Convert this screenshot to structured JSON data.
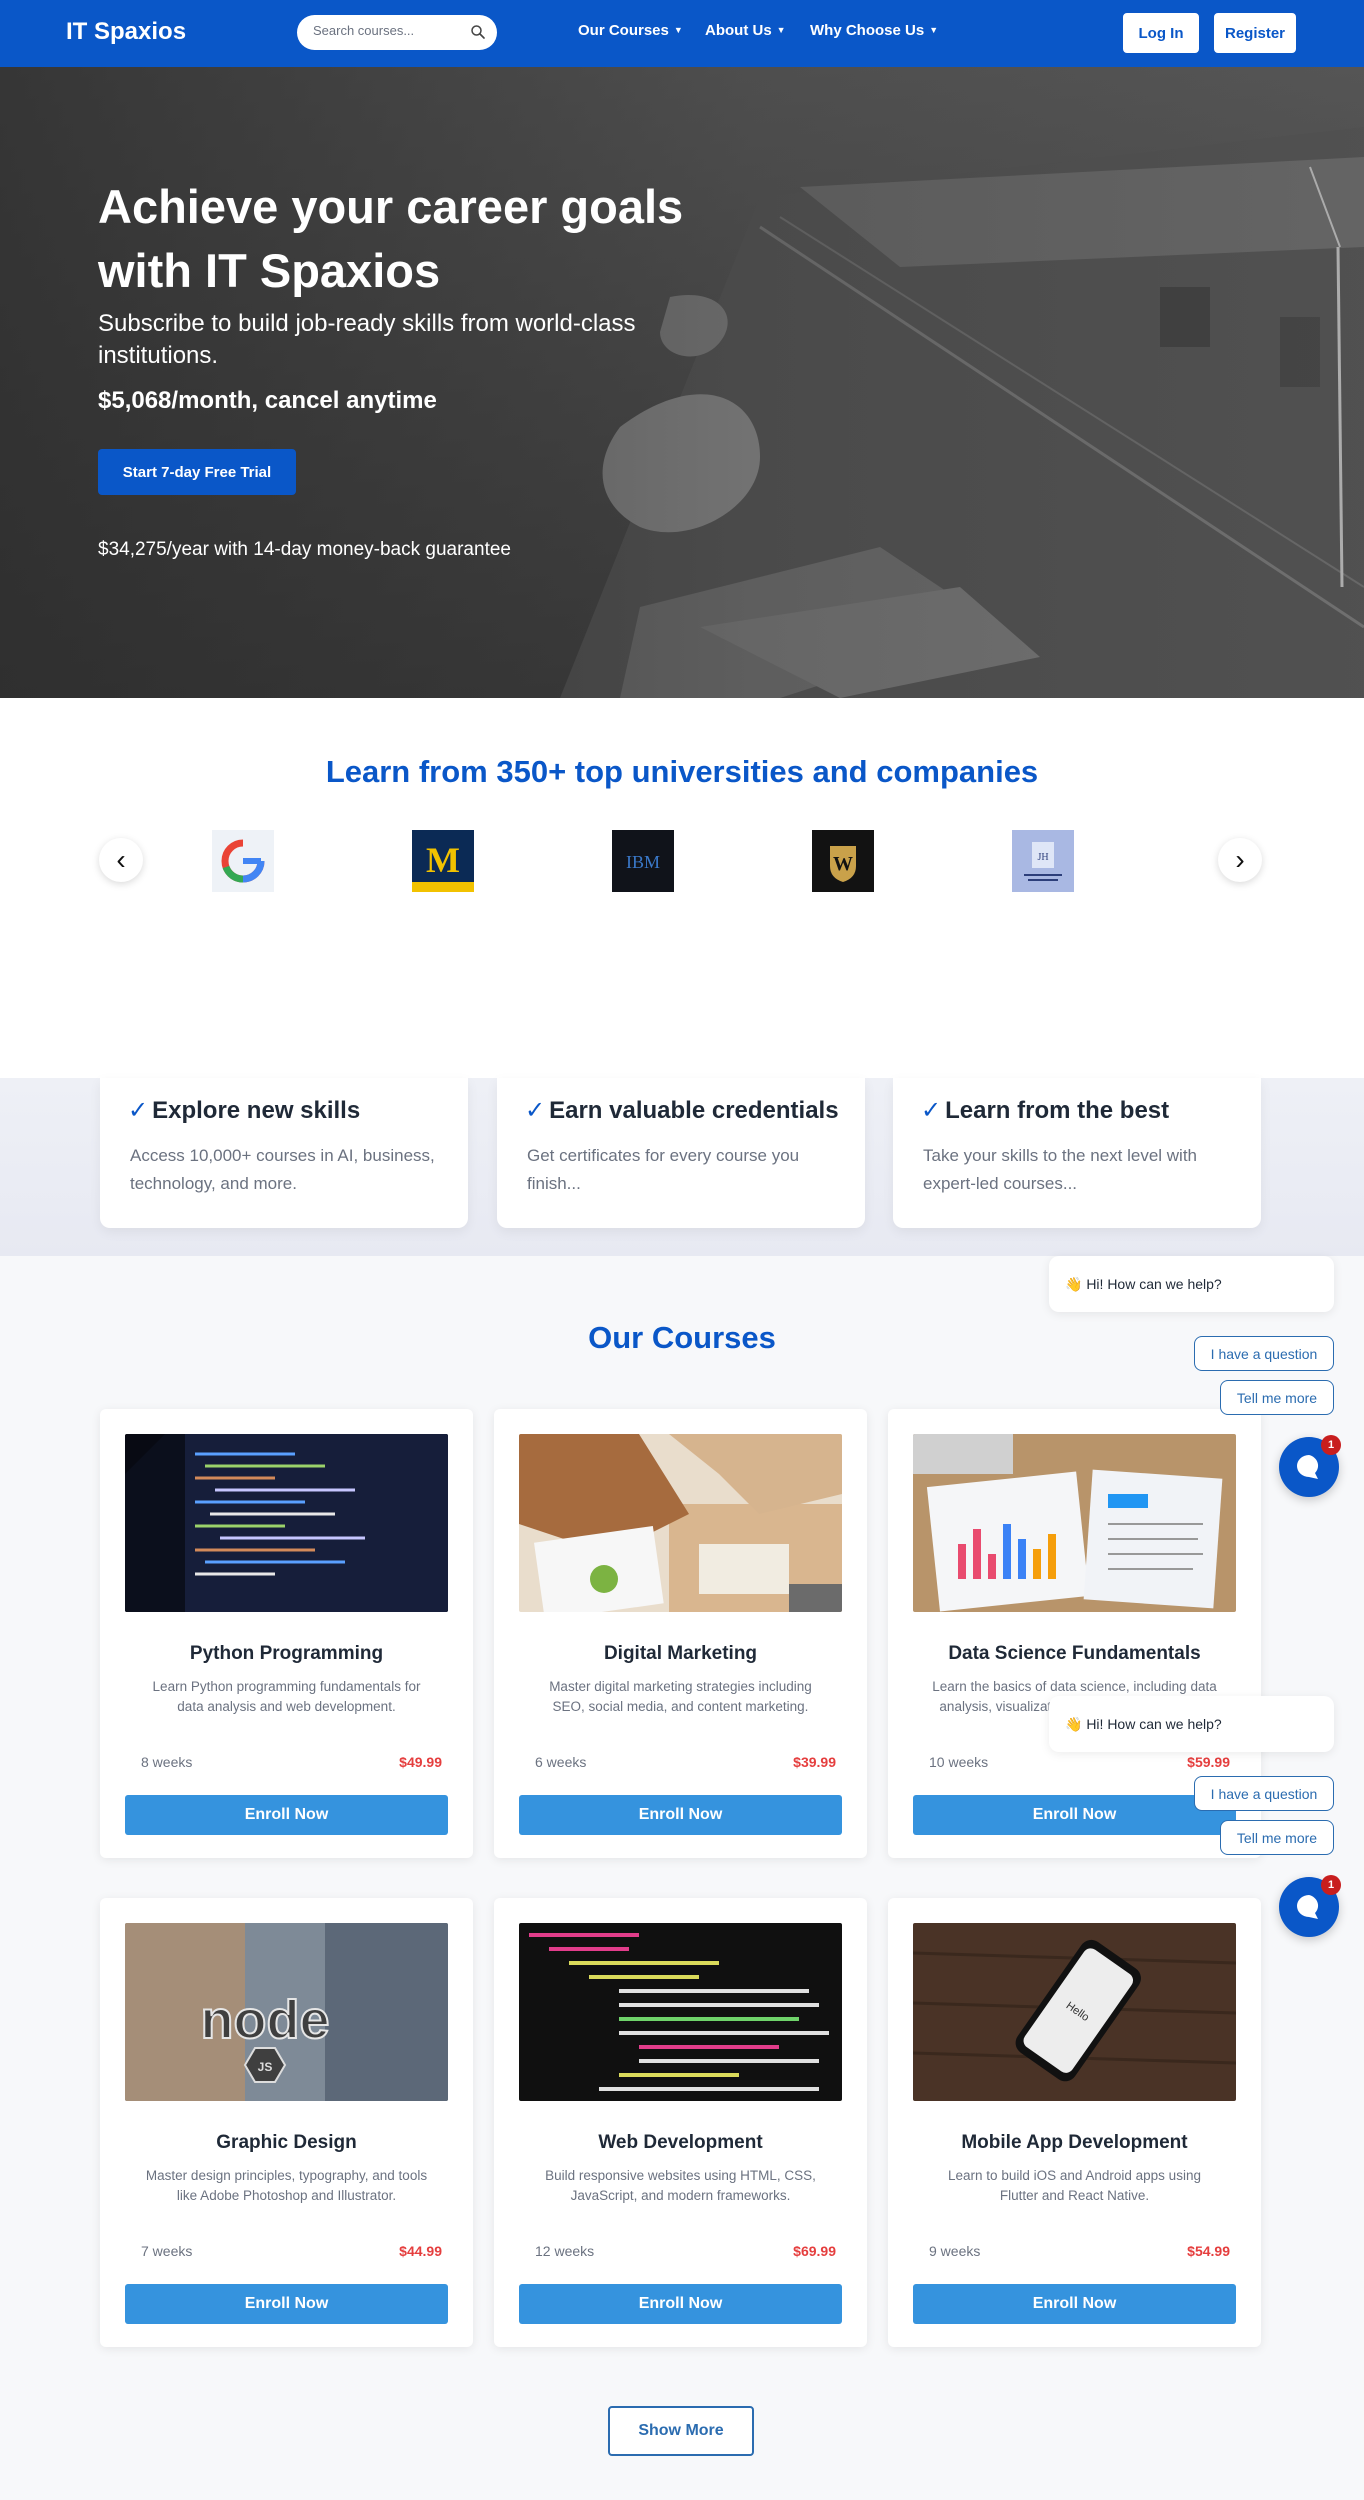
{
  "header": {
    "brand": "IT Spaxios",
    "search_placeholder": "Search courses...",
    "nav": [
      "Our Courses",
      "About Us",
      "Why Choose Us"
    ],
    "login": "Log In",
    "register": "Register"
  },
  "hero": {
    "title": "Achieve your career goals with IT Spaxios",
    "subtitle": "Subscribe to build job-ready skills from world-class institutions.",
    "price": "$5,068/month, cancel anytime",
    "cta": "Start 7-day Free Trial",
    "guarantee": "$34,275/year with 14-day money-back guarantee"
  },
  "partners": {
    "title": "Learn from 350+ top universities and companies",
    "prev": "‹",
    "next": "›",
    "logos": [
      "google-logo",
      "michigan-logo",
      "ibm-logo",
      "vanderbilt-logo",
      "johns-hopkins-logo"
    ],
    "logo_text": {
      "michigan": "M",
      "ibm": "IBM",
      "vanderbilt": "W",
      "jh": "JH"
    }
  },
  "features": [
    {
      "check": "✓",
      "title": "Explore new skills",
      "text": "Access 10,000+ courses in AI, business, technology, and more."
    },
    {
      "check": "✓",
      "title": "Earn valuable credentials",
      "text": "Get certificates for every course you finish..."
    },
    {
      "check": "✓",
      "title": "Learn from the best",
      "text": "Take your skills to the next level with expert-led courses..."
    }
  ],
  "courses": {
    "title": "Our Courses",
    "enroll_label": "Enroll Now",
    "show_more": "Show More",
    "items": [
      {
        "name": "Python Programming",
        "desc": "Learn Python programming fundamentals for data analysis and web development.",
        "duration": "8 weeks",
        "price": "$49.99"
      },
      {
        "name": "Digital Marketing",
        "desc": "Master digital marketing strategies including SEO, social media, and content marketing.",
        "duration": "6 weeks",
        "price": "$39.99"
      },
      {
        "name": "Data Science Fundamentals",
        "desc": "Learn the basics of data science, including data analysis, visualization, and machine learning.",
        "duration": "10 weeks",
        "price": "$59.99"
      },
      {
        "name": "Graphic Design",
        "desc": "Master design principles, typography, and tools like Adobe Photoshop and Illustrator.",
        "duration": "7 weeks",
        "price": "$44.99"
      },
      {
        "name": "Web Development",
        "desc": "Build responsive websites using HTML, CSS, JavaScript, and modern frameworks.",
        "duration": "12 weeks",
        "price": "$69.99"
      },
      {
        "name": "Mobile App Development",
        "desc": "Learn to build iOS and Android apps using Flutter and React Native.",
        "duration": "9 weeks",
        "price": "$54.99"
      }
    ],
    "image_text": {
      "node": "node",
      "js": "JS",
      "phone": "Hello"
    }
  },
  "chat": {
    "greeting": "👋 Hi! How can we help?",
    "option1": "I have a question",
    "option2": "Tell me more",
    "badge": "1"
  },
  "colors": {
    "primary": "#0a57c8",
    "enroll": "#3593de",
    "price": "#e53e3e"
  }
}
